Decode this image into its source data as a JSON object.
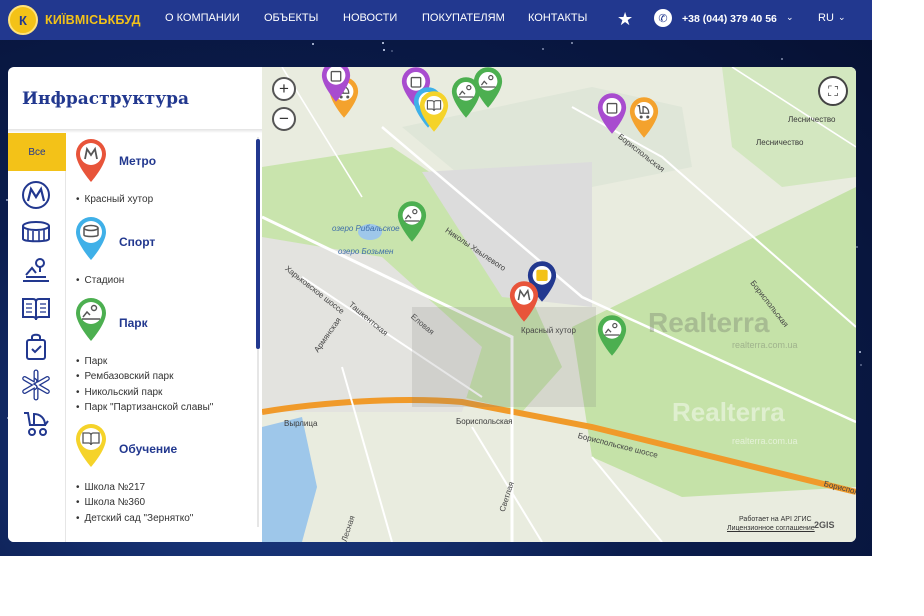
{
  "header": {
    "logo_mark": "К",
    "logo_text": "КИЇВМІСЬКБУД",
    "nav": [
      "О КОМПАНИИ",
      "ОБЪЕКТЫ",
      "НОВОСТИ",
      "ПОКУПАТЕЛЯМ",
      "КОНТАКТЫ"
    ],
    "phone": "+38 (044) 379 40 56",
    "language": "RU",
    "icons": {
      "favorite": "star-icon",
      "phone": "phone-icon",
      "dropdown": "chevron-down-icon"
    }
  },
  "panel": {
    "title": "Инфраструктура",
    "all_tab": "Все",
    "category_icons": [
      "metro-icon",
      "stadium-icon",
      "park-icon",
      "book-icon",
      "shopping-bag-icon",
      "medical-icon",
      "stroller-icon"
    ],
    "groups": [
      {
        "title": "Метро",
        "icon": "metro-icon",
        "color": "#e8543a",
        "items": [
          "Красный хутор"
        ]
      },
      {
        "title": "Спорт",
        "icon": "stadium-icon",
        "color": "#3fb0e8",
        "items": [
          "Стадион"
        ]
      },
      {
        "title": "Парк",
        "icon": "park-icon",
        "color": "#4caf50",
        "items": [
          "Парк",
          "Рембазовский парк",
          "Никольский парк",
          "Парк \"Партизанской славы\""
        ]
      },
      {
        "title": "Обучение",
        "icon": "book-icon",
        "color": "#f5d32a",
        "items": [
          "Школа №217",
          "Школа №360",
          "Детский сад \"Зернятко\""
        ]
      }
    ]
  },
  "map": {
    "place_labels": [
      "Лесничество",
      "Лесничество",
      "Красный хутор",
      "Вырлица",
      "Бориспольская"
    ],
    "streets": [
      "Бориспольская",
      "Николы Хвылевого",
      "Харьковское шоссе",
      "Ташкентская",
      "Еловая",
      "Армянская",
      "Бориспольская",
      "Бориспольское шоссе",
      "Светлая",
      "Бориспольская",
      "Лесная"
    ],
    "water": [
      "озеро Рибальское",
      "озеро Бозьмен"
    ],
    "watermark": "Realterra",
    "watermark_sub": "realterra.com.ua",
    "attribution": "Работает на API 2ГИС",
    "license": "Лицензионное соглашение",
    "provider": "2GIS",
    "zoom_in": "+",
    "zoom_out": "−",
    "fullscreen": "⛶",
    "colors": {
      "metro": "#e8543a",
      "sport": "#3fb0e8",
      "park": "#4caf50",
      "education": "#f5d32a",
      "shops": "#a84ccf",
      "kids": "#f4a22d",
      "project": "#22388f"
    }
  }
}
